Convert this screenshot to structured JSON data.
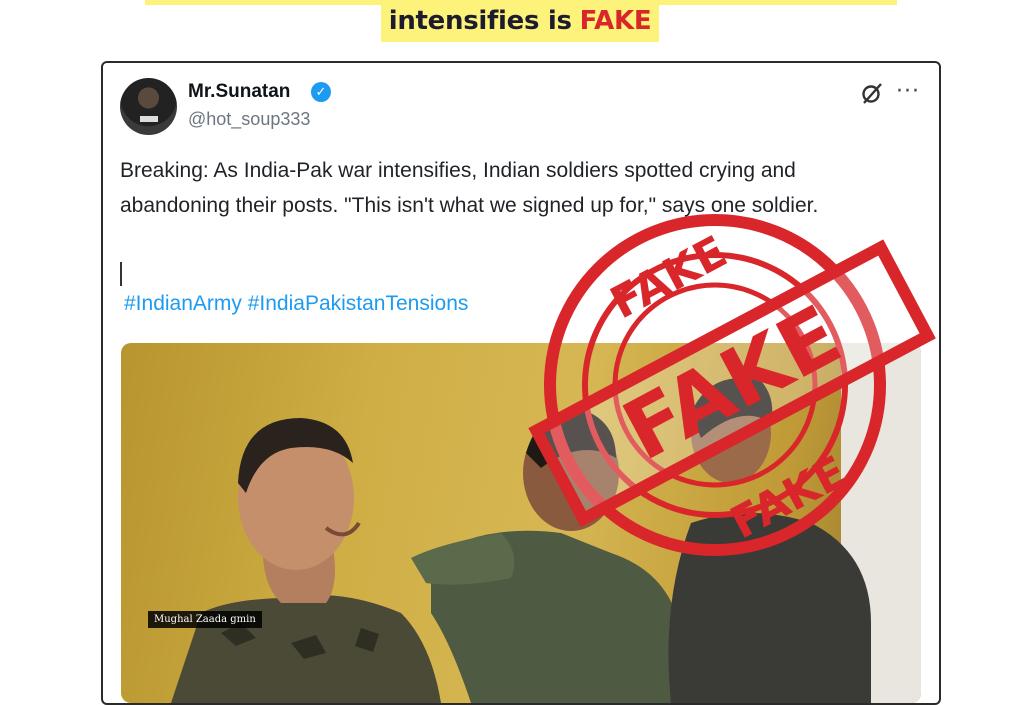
{
  "headline": {
    "text": "intensifies is",
    "fake_word": "FAKE"
  },
  "tweet": {
    "author_name": "Mr.Sunatan",
    "handle": "@hot_soup333",
    "text": "Breaking: As India-Pak war intensifies, Indian soldiers spotted crying and abandoning their posts. \"This isn't what we signed up for,\" says one soldier.",
    "hashtags": "#IndianArmy #IndiaPakistanTensions",
    "media_watermark": "Mughal Zaada gmin",
    "icons": {
      "verified": "verified-badge-icon",
      "grok": "grok-icon",
      "more": "more-icon"
    }
  },
  "stamp": {
    "words": [
      "FAKE",
      "FAKE",
      "FAKE"
    ],
    "color": "#d8262a"
  },
  "colors": {
    "highlight": "#fdf27a",
    "link": "#1d9bf0",
    "fake_red": "#d8262a"
  }
}
